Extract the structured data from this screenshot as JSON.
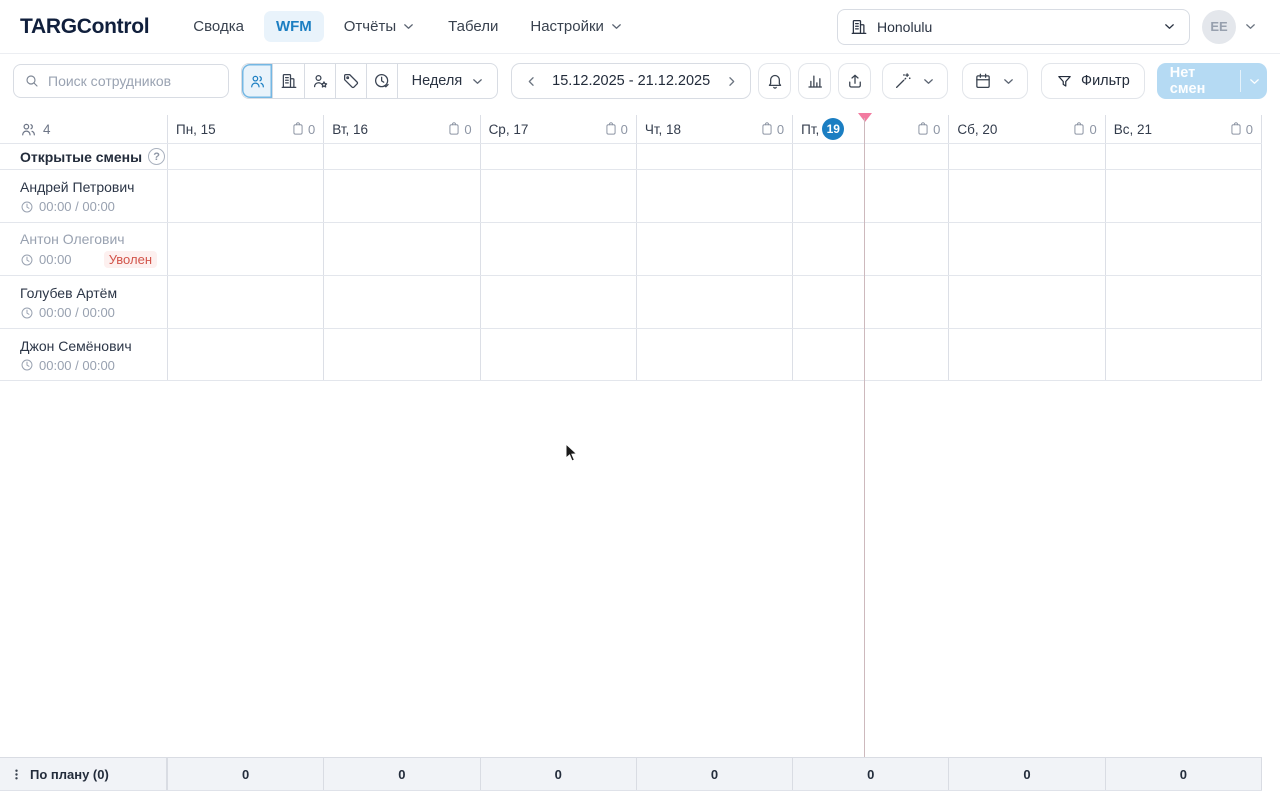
{
  "navbar": {
    "logo": "TARGControl",
    "items": [
      {
        "label": "Сводка",
        "active": false,
        "chevron": false
      },
      {
        "label": "WFM",
        "active": true,
        "chevron": false
      },
      {
        "label": "Отчёты",
        "active": false,
        "chevron": true
      },
      {
        "label": "Табели",
        "active": false,
        "chevron": false
      },
      {
        "label": "Настройки",
        "active": false,
        "chevron": true
      }
    ],
    "location": "Honolulu",
    "avatar_initials": "EE"
  },
  "toolbar": {
    "search_placeholder": "Поиск сотрудников",
    "view_modes": [
      "employees",
      "departments",
      "employee-star",
      "tags",
      "time-check"
    ],
    "active_view_mode": 0,
    "period_label": "Неделя",
    "date_range": "15.12.2025 - 21.12.2025",
    "filter_label": "Фильтр",
    "no_shifts_label": "Нет смен"
  },
  "schedule": {
    "employee_count": "4",
    "days": [
      {
        "label": "Пн, 15",
        "badge": null,
        "count": "0"
      },
      {
        "label": "Вт, 16",
        "badge": null,
        "count": "0"
      },
      {
        "label": "Ср, 17",
        "badge": null,
        "count": "0"
      },
      {
        "label": "Чт, 18",
        "badge": null,
        "count": "0"
      },
      {
        "label": "Пт,",
        "badge": "19",
        "count": "0"
      },
      {
        "label": "Сб, 20",
        "badge": null,
        "count": "0"
      },
      {
        "label": "Вс, 21",
        "badge": null,
        "count": "0"
      }
    ],
    "today_index": 4,
    "open_shifts_label": "Открытые смены",
    "employees": [
      {
        "name": "Андрей Петрович",
        "time": "00:00 / 00:00",
        "fired": false,
        "fired_label": ""
      },
      {
        "name": "Антон Олегович",
        "time": "00:00",
        "fired": true,
        "fired_label": "Уволен"
      },
      {
        "name": "Голубев Артём",
        "time": "00:00 / 00:00",
        "fired": false,
        "fired_label": ""
      },
      {
        "name": "Джон Семёнович",
        "time": "00:00 / 00:00",
        "fired": false,
        "fired_label": ""
      }
    ],
    "summary": {
      "label": "По плану (0)",
      "values": [
        "0",
        "0",
        "0",
        "0",
        "0",
        "0",
        "0"
      ]
    }
  },
  "colors": {
    "accent": "#1b7ec2",
    "accent_bg": "#e9f3fb",
    "today_badge": "#1b7ec2",
    "fired_red": "#d2544a",
    "no_shifts_bg": "#b5daf3",
    "grid_border": "#dcdfe6"
  }
}
